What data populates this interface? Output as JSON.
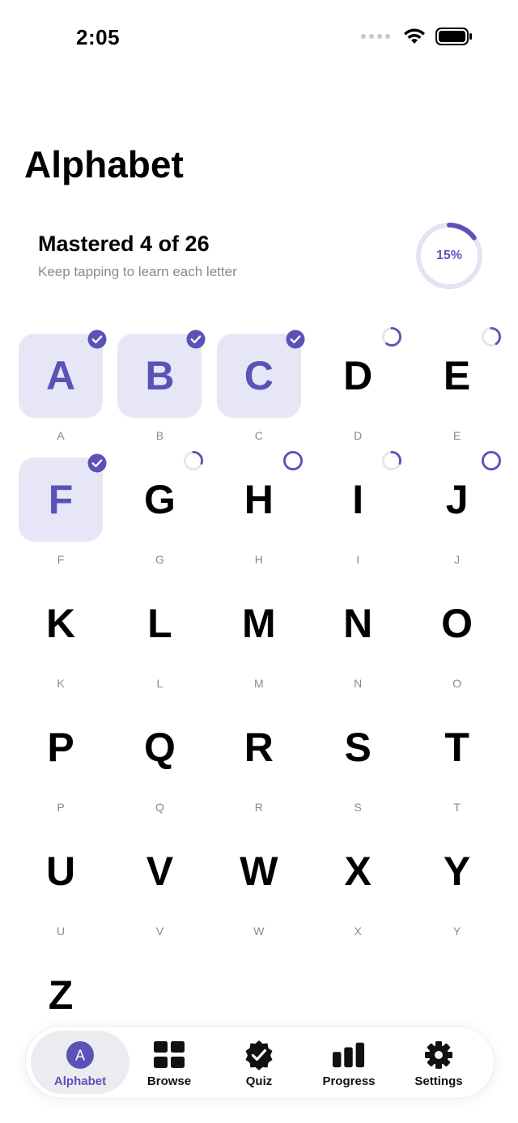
{
  "status": {
    "time": "2:05"
  },
  "header": {
    "title": "Alphabet"
  },
  "summary": {
    "title": "Mastered 4 of 26",
    "subtitle": "Keep tapping to learn each letter",
    "progress_label": "15%",
    "progress_fraction": 0.15
  },
  "letters": [
    {
      "glyph": "A",
      "label": "A",
      "state": "mastered"
    },
    {
      "glyph": "B",
      "label": "B",
      "state": "mastered"
    },
    {
      "glyph": "C",
      "label": "C",
      "state": "mastered"
    },
    {
      "glyph": "D",
      "label": "D",
      "state": "progress",
      "progress": 0.6
    },
    {
      "glyph": "E",
      "label": "E",
      "state": "progress",
      "progress": 0.4
    },
    {
      "glyph": "F",
      "label": "F",
      "state": "mastered"
    },
    {
      "glyph": "G",
      "label": "G",
      "state": "progress",
      "progress": 0.3
    },
    {
      "glyph": "H",
      "label": "H",
      "state": "progress",
      "progress": 1.0
    },
    {
      "glyph": "I",
      "label": "I",
      "state": "progress",
      "progress": 0.3
    },
    {
      "glyph": "J",
      "label": "J",
      "state": "progress",
      "progress": 1.0
    },
    {
      "glyph": "K",
      "label": "K",
      "state": "none"
    },
    {
      "glyph": "L",
      "label": "L",
      "state": "none"
    },
    {
      "glyph": "M",
      "label": "M",
      "state": "none"
    },
    {
      "glyph": "N",
      "label": "N",
      "state": "none"
    },
    {
      "glyph": "O",
      "label": "O",
      "state": "none"
    },
    {
      "glyph": "P",
      "label": "P",
      "state": "none"
    },
    {
      "glyph": "Q",
      "label": "Q",
      "state": "none"
    },
    {
      "glyph": "R",
      "label": "R",
      "state": "none"
    },
    {
      "glyph": "S",
      "label": "S",
      "state": "none"
    },
    {
      "glyph": "T",
      "label": "T",
      "state": "none"
    },
    {
      "glyph": "U",
      "label": "U",
      "state": "none"
    },
    {
      "glyph": "V",
      "label": "V",
      "state": "none"
    },
    {
      "glyph": "W",
      "label": "W",
      "state": "none"
    },
    {
      "glyph": "X",
      "label": "X",
      "state": "none"
    },
    {
      "glyph": "Y",
      "label": "Y",
      "state": "none"
    },
    {
      "glyph": "Z",
      "label": "Z",
      "state": "none"
    }
  ],
  "tabbar": {
    "tabs": [
      {
        "label": "Alphabet",
        "icon": "alphabet-icon",
        "active": true
      },
      {
        "label": "Browse",
        "icon": "grid-icon",
        "active": false
      },
      {
        "label": "Quiz",
        "icon": "quiz-badge-icon",
        "active": false
      },
      {
        "label": "Progress",
        "icon": "bar-chart-icon",
        "active": false
      },
      {
        "label": "Settings",
        "icon": "gear-icon",
        "active": false
      }
    ]
  },
  "colors": {
    "accent": "#5b52b8",
    "tile_mastered_bg": "#e7e6f6",
    "ring_track": "#e4e3f3",
    "progress_track": "#e5e5ea"
  }
}
